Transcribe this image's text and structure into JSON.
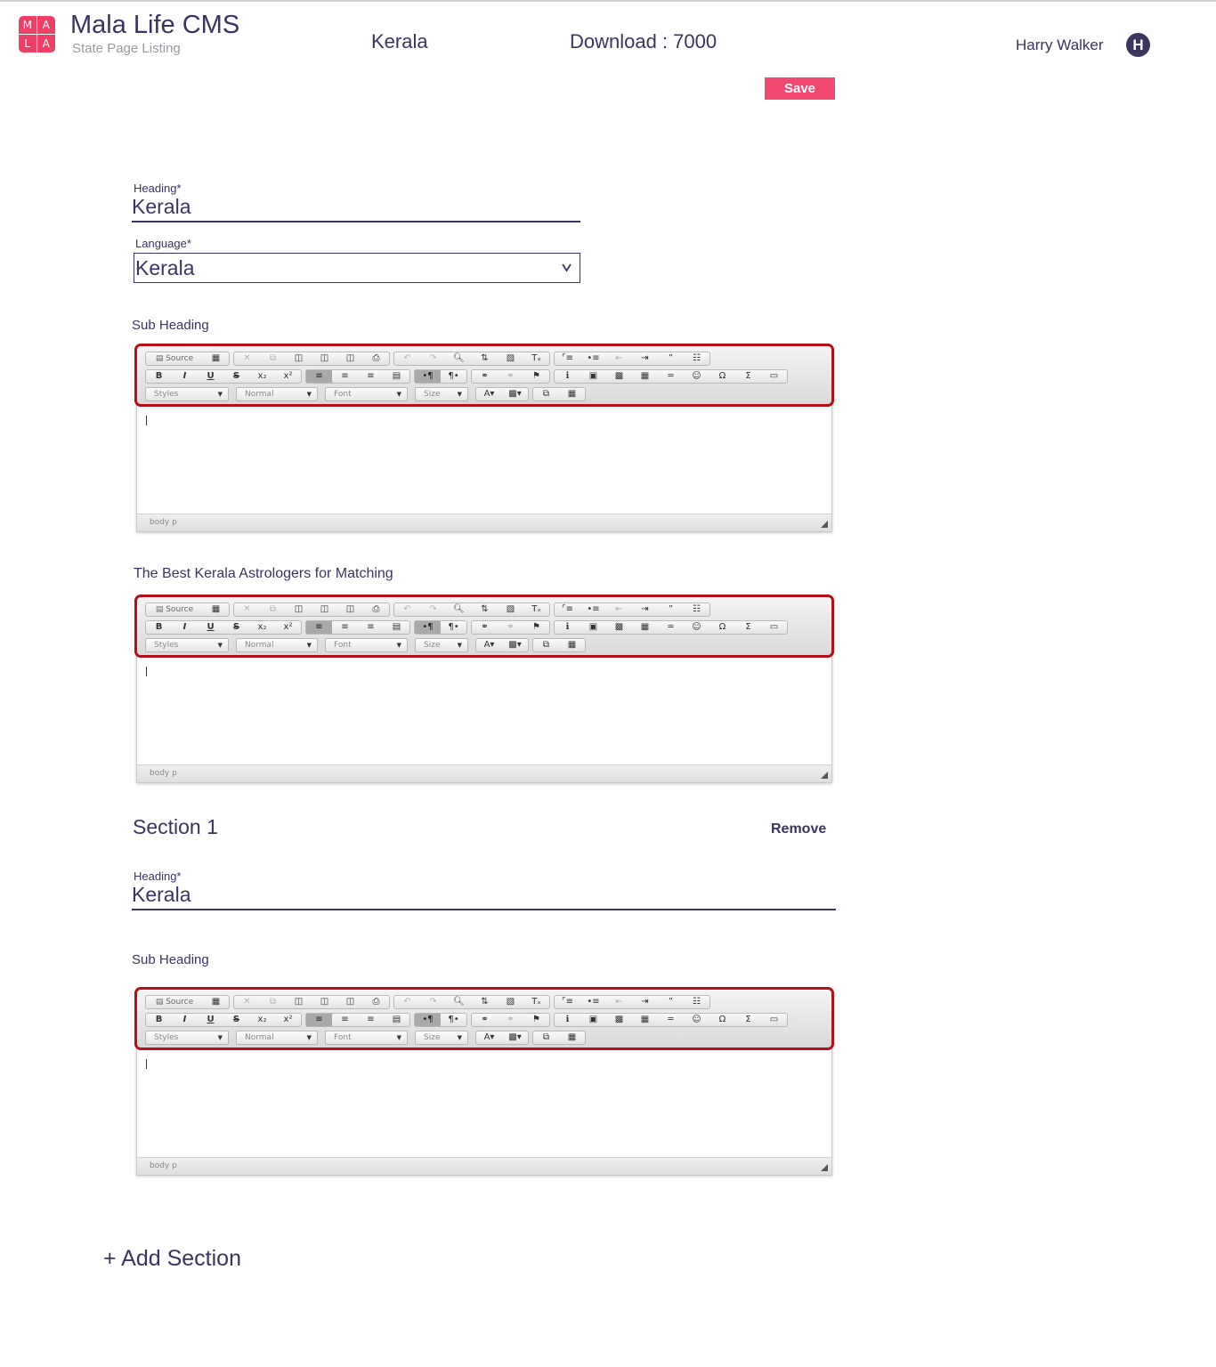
{
  "header": {
    "app_title": "Mala Life CMS",
    "app_subtitle": "State Page Listing",
    "logo_letters": [
      "M",
      "A",
      "L",
      "A"
    ],
    "state": "Kerala",
    "download": "Download : 7000",
    "user_name": "Harry Walker",
    "avatar_initial": "H",
    "brand_color": "#ee4067"
  },
  "toolbar": {
    "save_label": "Save"
  },
  "form": {
    "heading_label": "Heading*",
    "heading_value": "Kerala",
    "language_label": "Language*",
    "language_value": "Kerala",
    "subheading_label": "Sub Heading",
    "astrologers_label": "The Best Kerala Astrologers for Matching"
  },
  "section1": {
    "title": "Section 1",
    "remove_label": "Remove",
    "heading_label": "Heading*",
    "heading_value": "Kerala",
    "subheading_label": "Sub Heading"
  },
  "add_section_label": "+ Add Section",
  "editor": {
    "source_label": "Source",
    "styles_label": "Styles",
    "format_label": "Normal",
    "font_label": "Font",
    "size_label": "Size",
    "path_label": "body p"
  }
}
